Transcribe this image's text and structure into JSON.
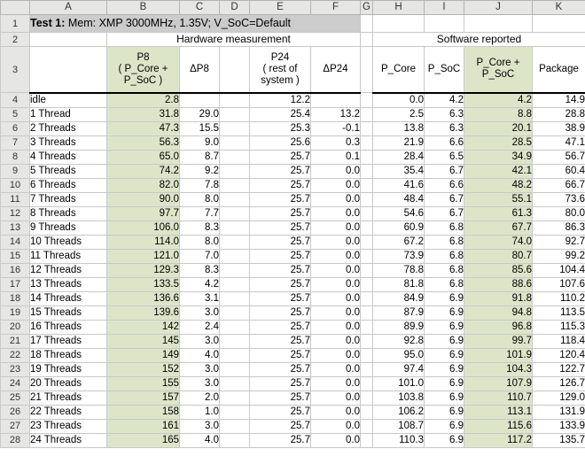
{
  "spreadsheet": {
    "column_letters": [
      "A",
      "B",
      "C",
      "D",
      "E",
      "F",
      "G",
      "H",
      "I",
      "J",
      "K"
    ],
    "row_numbers": [
      "1",
      "2",
      "3",
      "4",
      "5",
      "6",
      "7",
      "8",
      "9",
      "10",
      "11",
      "12",
      "13",
      "14",
      "15",
      "16",
      "17",
      "18",
      "19",
      "20",
      "21",
      "22",
      "23",
      "24",
      "25",
      "26",
      "27",
      "28"
    ],
    "title": {
      "label_bold": "Test 1:",
      "label_rest": " Mem: XMP 3000MHz, 1.35V; V_SoC=Default"
    },
    "group_headers": {
      "hardware": "Hardware measurement",
      "software": "Software reported"
    },
    "column_headers": {
      "a": "",
      "b_line1": "P8",
      "b_line2": "( P_Core +",
      "b_line3": "P_SoC )",
      "c": "ΔP8",
      "d": "",
      "e_line1": "P24",
      "e_line2": "( rest of",
      "e_line3": "system )",
      "f": "ΔP24",
      "g": "",
      "h": "P_Core",
      "i": "P_SoC",
      "j_line1": "P_Core +",
      "j_line2": "P_SoC",
      "k": "Package"
    },
    "highlight_colors": {
      "green_tint": "#dde5c9",
      "title_grey": "#cccccc",
      "header_grey": "#e6e6e3"
    },
    "rows": [
      {
        "n": "4",
        "a": "idle",
        "b": "2.8",
        "c": "",
        "d": "",
        "e": "12.2",
        "f": "",
        "g": "",
        "h": "0.0",
        "i": "4.2",
        "j": "4.2",
        "k": "14.9"
      },
      {
        "n": "5",
        "a": "1 Thread",
        "b": "31.8",
        "c": "29.0",
        "d": "",
        "e": "25.4",
        "f": "13.2",
        "g": "",
        "h": "2.5",
        "i": "6.3",
        "j": "8.8",
        "k": "28.8"
      },
      {
        "n": "6",
        "a": "2 Threads",
        "b": "47.3",
        "c": "15.5",
        "d": "",
        "e": "25.3",
        "f": "-0.1",
        "g": "",
        "h": "13.8",
        "i": "6.3",
        "j": "20.1",
        "k": "38.9"
      },
      {
        "n": "7",
        "a": "3 Threads",
        "b": "56.3",
        "c": "9.0",
        "d": "",
        "e": "25.6",
        "f": "0.3",
        "g": "",
        "h": "21.9",
        "i": "6.6",
        "j": "28.5",
        "k": "47.1"
      },
      {
        "n": "8",
        "a": "4 Threads",
        "b": "65.0",
        "c": "8.7",
        "d": "",
        "e": "25.7",
        "f": "0.1",
        "g": "",
        "h": "28.4",
        "i": "6.5",
        "j": "34.9",
        "k": "56.7"
      },
      {
        "n": "9",
        "a": "5 Threads",
        "b": "74.2",
        "c": "9.2",
        "d": "",
        "e": "25.7",
        "f": "0.0",
        "g": "",
        "h": "35.4",
        "i": "6.7",
        "j": "42.1",
        "k": "60.4"
      },
      {
        "n": "10",
        "a": "6 Threads",
        "b": "82.0",
        "c": "7.8",
        "d": "",
        "e": "25.7",
        "f": "0.0",
        "g": "",
        "h": "41.6",
        "i": "6.6",
        "j": "48.2",
        "k": "66.7"
      },
      {
        "n": "11",
        "a": "7 Threads",
        "b": "90.0",
        "c": "8.0",
        "d": "",
        "e": "25.7",
        "f": "0.0",
        "g": "",
        "h": "48.4",
        "i": "6.7",
        "j": "55.1",
        "k": "73.6"
      },
      {
        "n": "12",
        "a": "8 Threads",
        "b": "97.7",
        "c": "7.7",
        "d": "",
        "e": "25.7",
        "f": "0.0",
        "g": "",
        "h": "54.6",
        "i": "6.7",
        "j": "61.3",
        "k": "80.0"
      },
      {
        "n": "13",
        "a": "9 Threads",
        "b": "106.0",
        "c": "8.3",
        "d": "",
        "e": "25.7",
        "f": "0.0",
        "g": "",
        "h": "60.9",
        "i": "6.8",
        "j": "67.7",
        "k": "86.3"
      },
      {
        "n": "14",
        "a": "10 Threads",
        "b": "114.0",
        "c": "8.0",
        "d": "",
        "e": "25.7",
        "f": "0.0",
        "g": "",
        "h": "67.2",
        "i": "6.8",
        "j": "74.0",
        "k": "92.7"
      },
      {
        "n": "15",
        "a": "11 Threads",
        "b": "121.0",
        "c": "7.0",
        "d": "",
        "e": "25.7",
        "f": "0.0",
        "g": "",
        "h": "73.9",
        "i": "6.8",
        "j": "80.7",
        "k": "99.2"
      },
      {
        "n": "16",
        "a": "12 Threads",
        "b": "129.3",
        "c": "8.3",
        "d": "",
        "e": "25.7",
        "f": "0.0",
        "g": "",
        "h": "78.8",
        "i": "6.8",
        "j": "85.6",
        "k": "104.4"
      },
      {
        "n": "17",
        "a": "13 Threads",
        "b": "133.5",
        "c": "4.2",
        "d": "",
        "e": "25.7",
        "f": "0.0",
        "g": "",
        "h": "81.8",
        "i": "6.8",
        "j": "88.6",
        "k": "107.6"
      },
      {
        "n": "18",
        "a": "14 Threads",
        "b": "136.6",
        "c": "3.1",
        "d": "",
        "e": "25.7",
        "f": "0.0",
        "g": "",
        "h": "84.9",
        "i": "6.9",
        "j": "91.8",
        "k": "110.2"
      },
      {
        "n": "19",
        "a": "15 Threads",
        "b": "139.6",
        "c": "3.0",
        "d": "",
        "e": "25.7",
        "f": "0.0",
        "g": "",
        "h": "87.9",
        "i": "6.9",
        "j": "94.8",
        "k": "113.5"
      },
      {
        "n": "20",
        "a": "16 Threads",
        "b": "142",
        "c": "2.4",
        "d": "",
        "e": "25.7",
        "f": "0.0",
        "g": "",
        "h": "89.9",
        "i": "6.9",
        "j": "96.8",
        "k": "115.3"
      },
      {
        "n": "21",
        "a": "17 Threads",
        "b": "145",
        "c": "3.0",
        "d": "",
        "e": "25.7",
        "f": "0.0",
        "g": "",
        "h": "92.8",
        "i": "6.9",
        "j": "99.7",
        "k": "118.4"
      },
      {
        "n": "22",
        "a": "18 Threads",
        "b": "149",
        "c": "4.0",
        "d": "",
        "e": "25.7",
        "f": "0.0",
        "g": "",
        "h": "95.0",
        "i": "6.9",
        "j": "101.9",
        "k": "120.4"
      },
      {
        "n": "23",
        "a": "19 Threads",
        "b": "152",
        "c": "3.0",
        "d": "",
        "e": "25.7",
        "f": "0.0",
        "g": "",
        "h": "97.4",
        "i": "6.9",
        "j": "104.3",
        "k": "122.7"
      },
      {
        "n": "24",
        "a": "20 Threads",
        "b": "155",
        "c": "3.0",
        "d": "",
        "e": "25.7",
        "f": "0.0",
        "g": "",
        "h": "101.0",
        "i": "6.9",
        "j": "107.9",
        "k": "126.7"
      },
      {
        "n": "25",
        "a": "21 Threads",
        "b": "157",
        "c": "2.0",
        "d": "",
        "e": "25.7",
        "f": "0.0",
        "g": "",
        "h": "103.8",
        "i": "6.9",
        "j": "110.7",
        "k": "129.0"
      },
      {
        "n": "26",
        "a": "22 Threads",
        "b": "158",
        "c": "1.0",
        "d": "",
        "e": "25.7",
        "f": "0.0",
        "g": "",
        "h": "106.2",
        "i": "6.9",
        "j": "113.1",
        "k": "131.9"
      },
      {
        "n": "27",
        "a": "23 Threads",
        "b": "161",
        "c": "3.0",
        "d": "",
        "e": "25.7",
        "f": "0.0",
        "g": "",
        "h": "108.7",
        "i": "6.9",
        "j": "115.6",
        "k": "133.9"
      },
      {
        "n": "28",
        "a": "24 Threads",
        "b": "165",
        "c": "4.0",
        "d": "",
        "e": "25.7",
        "f": "0.0",
        "g": "",
        "h": "110.3",
        "i": "6.9",
        "j": "117.2",
        "k": "135.7"
      }
    ]
  }
}
